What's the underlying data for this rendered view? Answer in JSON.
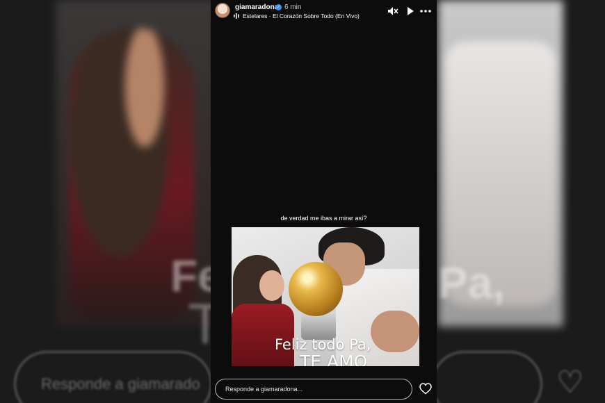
{
  "story": {
    "username": "giamaradona",
    "time": "6 min",
    "music": "Estelares · El Corazón Sobre Todo (En Vivo)",
    "caption": "de verdad me ibas a mirar así?",
    "photo_text_line1": "Feliz todo Pa,",
    "photo_text_line2": "TE AMO",
    "icons": [
      "mute-icon",
      "play-icon",
      "more-icon",
      "heart-icon",
      "verified-icon",
      "music-icon"
    ]
  },
  "reply": {
    "placeholder": "Responde a giamaradona..."
  },
  "background": {
    "text_left": "Feliz",
    "text_left2": "TE",
    "text_right": "Pa,",
    "reply_preview": "Responde a giamarado"
  },
  "colors": {
    "story_bg": "#0c0c0c",
    "verified": "#3897f0"
  }
}
